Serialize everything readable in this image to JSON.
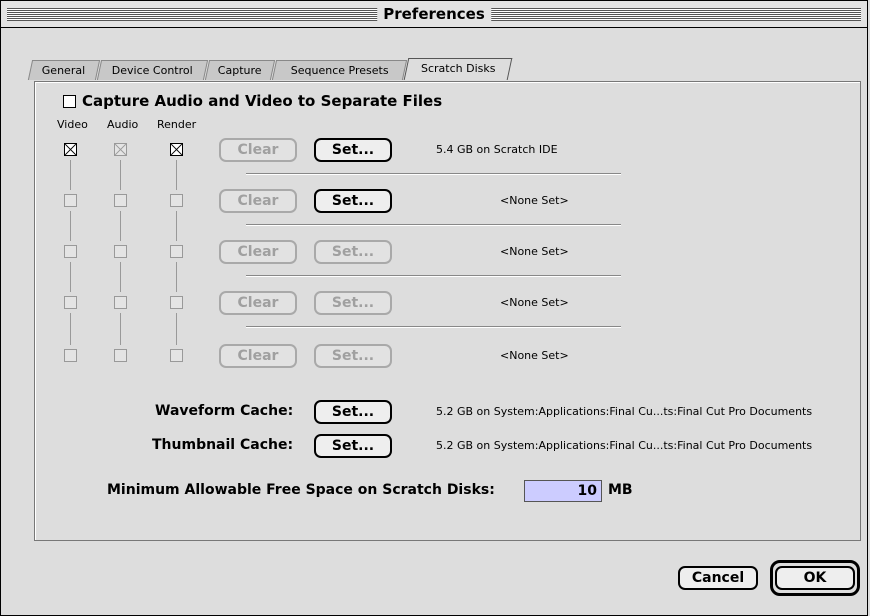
{
  "window": {
    "title": "Preferences"
  },
  "tabs": [
    "General",
    "Device Control",
    "Capture",
    "Sequence Presets",
    "Scratch Disks"
  ],
  "capture_separate": {
    "label": "Capture Audio and Video to Separate Files",
    "checked": false
  },
  "columns": [
    "Video",
    "Audio",
    "Render"
  ],
  "disks": [
    {
      "video": true,
      "audio": true,
      "render": true,
      "enabled": true,
      "clear": "Clear",
      "set": "Set...",
      "set_enabled": true,
      "info": "5.4 GB on Scratch IDE"
    },
    {
      "video": false,
      "audio": false,
      "render": false,
      "enabled": false,
      "clear": "Clear",
      "set": "Set...",
      "set_enabled": true,
      "info": "<None Set>"
    },
    {
      "video": false,
      "audio": false,
      "render": false,
      "enabled": false,
      "clear": "Clear",
      "set": "Set...",
      "set_enabled": false,
      "info": "<None Set>"
    },
    {
      "video": false,
      "audio": false,
      "render": false,
      "enabled": false,
      "clear": "Clear",
      "set": "Set...",
      "set_enabled": false,
      "info": "<None Set>"
    },
    {
      "video": false,
      "audio": false,
      "render": false,
      "enabled": false,
      "clear": "Clear",
      "set": "Set...",
      "set_enabled": false,
      "info": "<None Set>"
    }
  ],
  "waveform": {
    "label": "Waveform Cache:",
    "set": "Set...",
    "info": "5.2 GB on System:Applications:Final Cu...ts:Final Cut Pro Documents"
  },
  "thumbnail": {
    "label": "Thumbnail Cache:",
    "set": "Set...",
    "info": "5.2 GB on System:Applications:Final Cu...ts:Final Cut Pro Documents"
  },
  "min_space": {
    "label": "Minimum Allowable Free Space on Scratch Disks:",
    "value": "10",
    "unit": "MB"
  },
  "buttons": {
    "cancel": "Cancel",
    "ok": "OK"
  }
}
